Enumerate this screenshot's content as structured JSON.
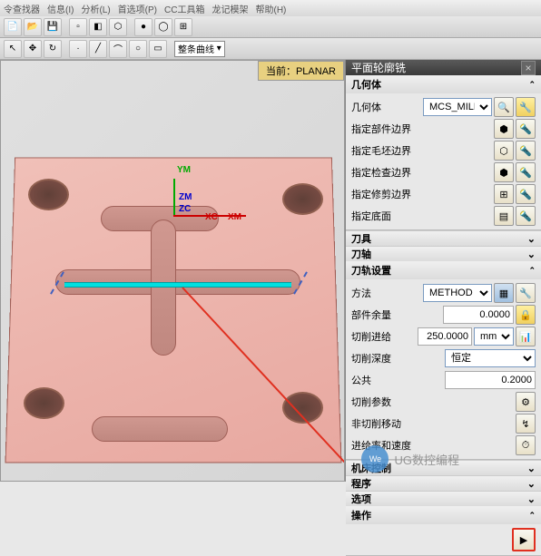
{
  "menu": {
    "items": [
      "令查找器",
      "信息(I)",
      "分析(L)",
      "首选项(P)",
      "CC工具箱",
      "龙记模架",
      "帮助(H)"
    ]
  },
  "toolbar2_dropdown": "整条曲线",
  "status": {
    "current_label": "当前：",
    "current_value": "PLANAR"
  },
  "axes": {
    "ym": "YM",
    "xc": "XC",
    "xm": "XM",
    "zc": "ZC",
    "zm": "ZM"
  },
  "panel": {
    "title": "平面轮廓铣",
    "geom": {
      "header": "几何体",
      "label": "几何体",
      "value": "MCS_MILL",
      "rows": [
        {
          "label": "指定部件边界"
        },
        {
          "label": "指定毛坯边界"
        },
        {
          "label": "指定检查边界"
        },
        {
          "label": "指定修剪边界"
        },
        {
          "label": "指定底面"
        }
      ]
    },
    "tool": {
      "header": "刀具"
    },
    "axis": {
      "header": "刀轴"
    },
    "track": {
      "header": "刀轨设置",
      "method_label": "方法",
      "method_value": "METHOD",
      "part_remain_label": "部件余量",
      "part_remain_value": "0.0000",
      "feed_label": "切削进给",
      "feed_value": "250.0000",
      "feed_unit": "mmpr",
      "depth_label": "切削深度",
      "depth_value": "恒定",
      "common_label": "公共",
      "common_value": "0.2000",
      "cut_params_label": "切削参数",
      "noncut_label": "非切削移动",
      "feedrate_label": "进给率和速度"
    },
    "machine": {
      "header": "机床控制"
    },
    "program": {
      "header": "程序"
    },
    "options": {
      "header": "选项"
    },
    "op": {
      "header": "操作"
    }
  },
  "watermark": {
    "text": "UG数控编程"
  }
}
